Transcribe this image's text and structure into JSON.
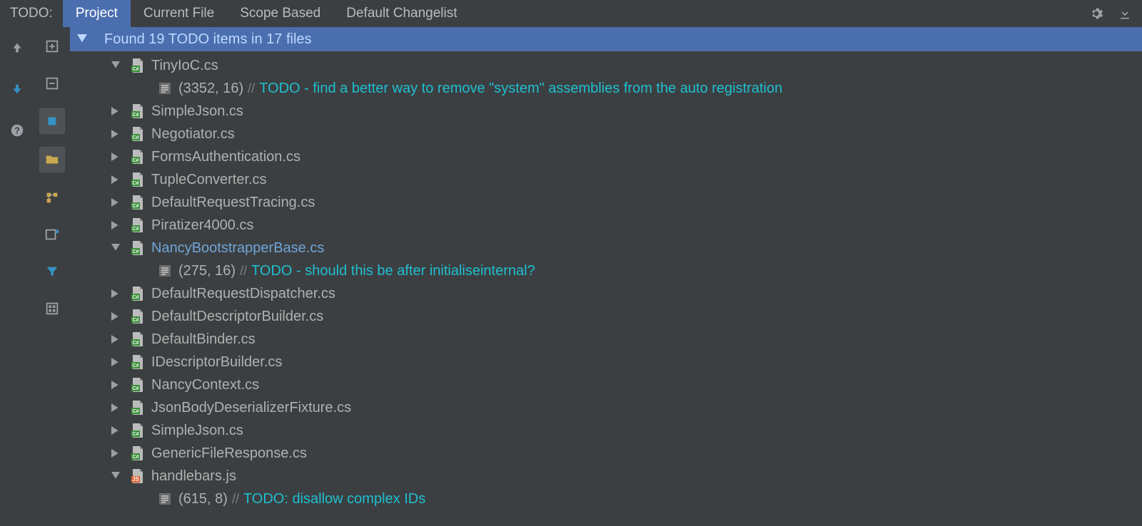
{
  "header": {
    "label": "TODO:",
    "tabs": [
      "Project",
      "Current File",
      "Scope Based",
      "Default Changelist"
    ],
    "active_tab_index": 0
  },
  "summary": "Found 19 TODO items in 17 files",
  "files": [
    {
      "name": "TinyIoC.cs",
      "lang": "cs",
      "expanded": true,
      "hi": false,
      "todos": [
        {
          "loc": "(3352, 16)",
          "msg": "TODO - find a better way to remove \"system\" assemblies from the auto registration"
        }
      ]
    },
    {
      "name": "SimpleJson.cs",
      "lang": "cs",
      "expanded": false,
      "hi": false,
      "todos": []
    },
    {
      "name": "Negotiator.cs",
      "lang": "cs",
      "expanded": false,
      "hi": false,
      "todos": []
    },
    {
      "name": "FormsAuthentication.cs",
      "lang": "cs",
      "expanded": false,
      "hi": false,
      "todos": []
    },
    {
      "name": "TupleConverter.cs",
      "lang": "cs",
      "expanded": false,
      "hi": false,
      "todos": []
    },
    {
      "name": "DefaultRequestTracing.cs",
      "lang": "cs",
      "expanded": false,
      "hi": false,
      "todos": []
    },
    {
      "name": "Piratizer4000.cs",
      "lang": "cs",
      "expanded": false,
      "hi": false,
      "todos": []
    },
    {
      "name": "NancyBootstrapperBase.cs",
      "lang": "cs",
      "expanded": true,
      "hi": true,
      "todos": [
        {
          "loc": "(275, 16)",
          "msg": "TODO - should this be after initialiseinternal?"
        }
      ]
    },
    {
      "name": "DefaultRequestDispatcher.cs",
      "lang": "cs",
      "expanded": false,
      "hi": false,
      "todos": []
    },
    {
      "name": "DefaultDescriptorBuilder.cs",
      "lang": "cs",
      "expanded": false,
      "hi": false,
      "todos": []
    },
    {
      "name": "DefaultBinder.cs",
      "lang": "cs",
      "expanded": false,
      "hi": false,
      "todos": []
    },
    {
      "name": "IDescriptorBuilder.cs",
      "lang": "cs",
      "expanded": false,
      "hi": false,
      "todos": []
    },
    {
      "name": "NancyContext.cs",
      "lang": "cs",
      "expanded": false,
      "hi": false,
      "todos": []
    },
    {
      "name": "JsonBodyDeserializerFixture.cs",
      "lang": "cs",
      "expanded": false,
      "hi": false,
      "todos": []
    },
    {
      "name": "SimpleJson.cs",
      "lang": "cs",
      "expanded": false,
      "hi": false,
      "todos": []
    },
    {
      "name": "GenericFileResponse.cs",
      "lang": "cs",
      "expanded": false,
      "hi": false,
      "todos": []
    },
    {
      "name": "handlebars.js",
      "lang": "js",
      "expanded": true,
      "hi": false,
      "todos": [
        {
          "loc": "(615, 8)",
          "msg": "TODO: disallow complex IDs"
        }
      ]
    }
  ],
  "colors": {
    "accent": "#4b6eaf",
    "todo": "#1fbfd1",
    "bg": "#3c3f41"
  }
}
